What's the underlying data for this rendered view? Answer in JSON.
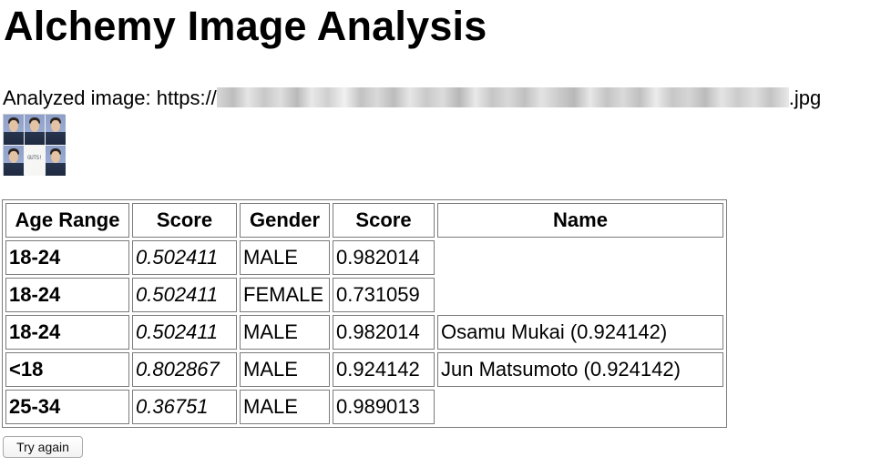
{
  "page": {
    "title": "Alchemy Image Analysis",
    "analyzed_prefix": "Analyzed image: https://",
    "analyzed_suffix": ".jpg"
  },
  "table": {
    "headers": [
      "Age Range",
      "Score",
      "Gender",
      "Score",
      "Name"
    ],
    "rows": [
      {
        "age_range": "18-24",
        "age_score": "0.502411",
        "gender": "MALE",
        "gender_score": "0.982014",
        "name": ""
      },
      {
        "age_range": "18-24",
        "age_score": "0.502411",
        "gender": "FEMALE",
        "gender_score": "0.731059",
        "name": ""
      },
      {
        "age_range": "18-24",
        "age_score": "0.502411",
        "gender": "MALE",
        "gender_score": "0.982014",
        "name": "Osamu Mukai (0.924142)"
      },
      {
        "age_range": "<18",
        "age_score": "0.802867",
        "gender": "MALE",
        "gender_score": "0.924142",
        "name": "Jun Matsumoto (0.924142)"
      },
      {
        "age_range": "25-34",
        "age_score": "0.36751",
        "gender": "MALE",
        "gender_score": "0.989013",
        "name": ""
      }
    ]
  },
  "actions": {
    "try_again_label": "Try again"
  },
  "thumbnail": {
    "logo_text": "GUTS!"
  }
}
